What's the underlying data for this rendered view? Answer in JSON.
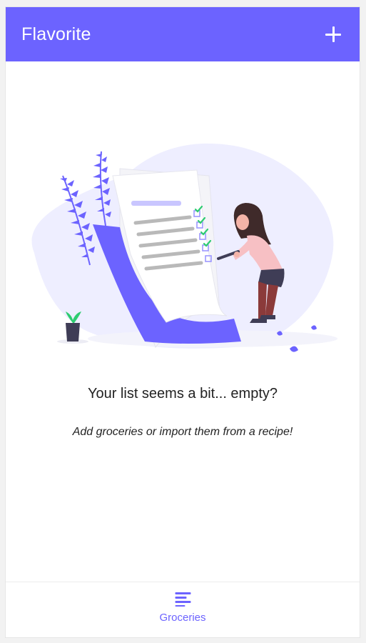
{
  "app_bar": {
    "title": "Flavorite",
    "add_icon": "plus-icon"
  },
  "empty_state": {
    "illustration": "checklist-woman-illustration",
    "title": "Your list seems a bit... empty?",
    "subtitle": "Add groceries or import them from a recipe!"
  },
  "bottom_nav": {
    "items": [
      {
        "label": "Groceries",
        "icon": "list-icon",
        "active": true
      }
    ]
  },
  "colors": {
    "accent": "#6c63ff",
    "background": "#ffffff",
    "text": "#222222"
  }
}
